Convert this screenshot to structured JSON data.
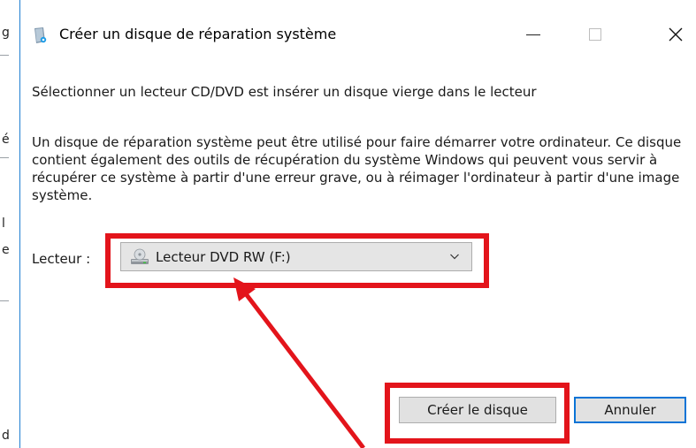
{
  "background_window": {
    "fragments": [
      "g",
      "é",
      "l",
      "e",
      "d"
    ]
  },
  "dialog": {
    "title": "Créer un disque de réparation système",
    "instruction": "Sélectionner un lecteur CD/DVD est insérer un disque vierge dans le lecteur",
    "description": "Un disque de réparation système peut être utilisé pour faire démarrer votre ordinateur. Ce disque contient également des outils de récupération du système Windows qui peuvent vous servir à récupérer ce système à partir d'une erreur grave, ou à réimager l'ordinateur à partir d'une image système.",
    "drive_label": "Lecteur :",
    "drive_selected": "Lecteur DVD RW (F:)",
    "create_button": "Créer le disque",
    "cancel_button": "Annuler"
  },
  "icons": {
    "app": "repair-disc-app-icon",
    "drive": "dvd-drive-icon",
    "dropdown": "chevron-down-icon",
    "minimize": "minimize-icon",
    "maximize": "maximize-icon",
    "close": "close-icon"
  },
  "colors": {
    "annotation": "#e3141b",
    "focus_border": "#0a74d6",
    "window_border": "#1f7fd1"
  }
}
